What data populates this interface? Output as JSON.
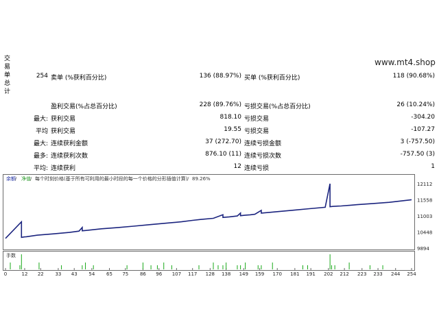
{
  "watermark": "www.mt4.shop",
  "side_title": [
    "交",
    "易",
    "单",
    "总",
    "计"
  ],
  "stats": {
    "total_trades": "254",
    "sell_label": "卖单 (%获利百分比)",
    "sell_value": "136 (88.97%)",
    "buy_label": "买单 (%获利百分比)",
    "buy_value": "118 (90.68%)",
    "profit_trades_label": "盈利交易(%占总百分比)",
    "profit_trades_value": "228 (89.76%)",
    "loss_trades_label": "亏损交易(%占总百分比)",
    "loss_trades_value": "26 (10.24%)",
    "row_max": "最大:",
    "row_avg": "平均",
    "row_max2": "最大:",
    "row_most": "最多:",
    "row_avg2": "平均:",
    "largest_profit_label": "获利交易",
    "largest_profit_value": "818.10",
    "largest_loss_label": "亏损交易",
    "largest_loss_value": "-304.20",
    "avg_profit_label": "获利交易",
    "avg_profit_value": "19.55",
    "avg_loss_label": "亏损交易",
    "avg_loss_value": "-107.27",
    "max_consec_wins_label": "连续获利金额",
    "max_consec_wins_value": "37 (272.70)",
    "max_consec_losses_label": "连续亏损金额",
    "max_consec_losses_value": "3 (-757.50)",
    "max_consec_profit_label": "连续获利次数",
    "max_consec_profit_value": "876.10 (11)",
    "max_consec_loss_label": "连续亏损次数",
    "max_consec_loss_value": "-757.50 (3)",
    "avg_consec_wins_label": "连续获利",
    "avg_consec_wins_value": "12",
    "avg_consec_losses_label": "连续亏损",
    "avg_consec_losses_value": "1"
  },
  "chart_data": {
    "type": "line",
    "legend_balance": "余额",
    "legend_equity": "净值",
    "legend_text": "每个时刻价格(基于所有可利用的最小时段的每一个价格的分形插值计算)",
    "legend_quality": "89.26%",
    "volume_label": "手数",
    "y_ticks": [
      12112,
      11558,
      11003,
      10448,
      9894
    ],
    "x_ticks": [
      0,
      12,
      22,
      33,
      43,
      54,
      65,
      75,
      86,
      96,
      107,
      117,
      128,
      138,
      149,
      159,
      170,
      181,
      191,
      202,
      212,
      223,
      233,
      244,
      254
    ],
    "xlim": [
      0,
      254
    ],
    "ylim": [
      9894,
      12112
    ],
    "grid": false,
    "series": [
      {
        "name": "余额",
        "x": [
          0,
          10,
          12,
          13,
          20,
          30,
          40,
          46,
          48,
          50,
          60,
          70,
          80,
          90,
          100,
          110,
          117,
          122,
          130,
          136,
          138,
          140,
          145,
          147,
          150,
          153,
          156,
          160,
          170,
          180,
          190,
          200,
          203,
          205,
          208,
          210,
          220,
          230,
          240,
          254
        ],
        "y": [
          10230,
          10265,
          10280,
          10285,
          10340,
          10385,
          10435,
          10480,
          10490,
          10500,
          10560,
          10600,
          10650,
          10700,
          10750,
          10800,
          10850,
          10880,
          10920,
          10950,
          10960,
          10970,
          11000,
          11010,
          11030,
          11040,
          11060,
          11100,
          11150,
          11200,
          11250,
          11300,
          11320,
          11330,
          11340,
          11345,
          11390,
          11430,
          11470,
          11560
        ]
      }
    ],
    "spikes": [
      {
        "x": 10,
        "y": 10800
      },
      {
        "x": 48,
        "y": 10605
      },
      {
        "x": 136,
        "y": 11043
      },
      {
        "x": 147,
        "y": 11103
      },
      {
        "x": 160,
        "y": 11193
      },
      {
        "x": 203,
        "y": 12112
      }
    ],
    "volume_x": [
      3,
      9,
      10,
      21,
      35,
      48,
      50,
      55,
      76,
      86,
      91,
      95,
      99,
      104,
      121,
      130,
      133,
      136,
      138,
      145,
      147,
      150,
      158,
      160,
      167,
      186,
      189,
      203,
      204,
      206,
      215,
      228,
      236
    ]
  }
}
